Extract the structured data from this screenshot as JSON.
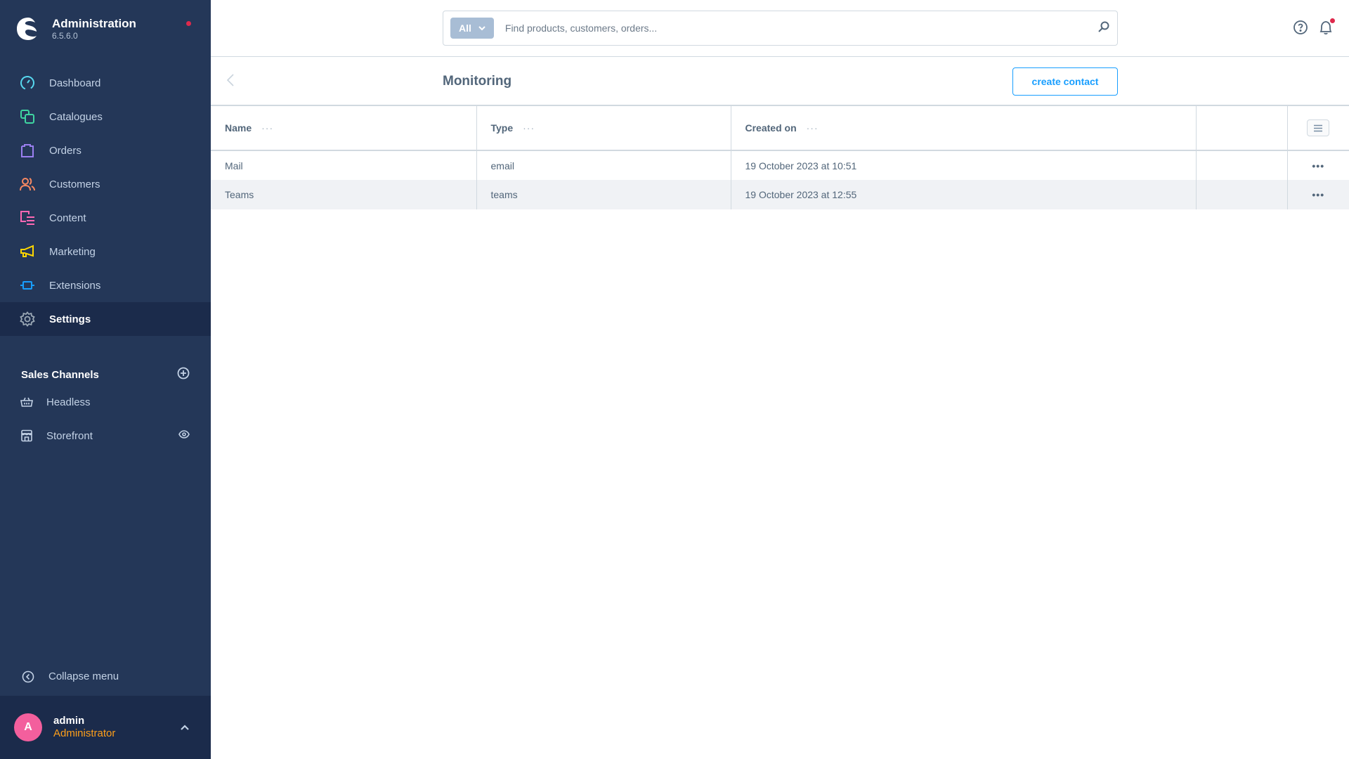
{
  "app": {
    "title": "Administration",
    "version": "6.5.6.0"
  },
  "sidebar": {
    "items": [
      {
        "label": "Dashboard",
        "icon": "dashboard-icon",
        "color": "#57d9f0"
      },
      {
        "label": "Catalogues",
        "icon": "catalogues-icon",
        "color": "#3fd5a1"
      },
      {
        "label": "Orders",
        "icon": "orders-icon",
        "color": "#9a7ff0"
      },
      {
        "label": "Customers",
        "icon": "customers-icon",
        "color": "#f88962"
      },
      {
        "label": "Content",
        "icon": "content-icon",
        "color": "#ff68b4"
      },
      {
        "label": "Marketing",
        "icon": "marketing-icon",
        "color": "#ffd700"
      },
      {
        "label": "Extensions",
        "icon": "extensions-icon",
        "color": "#189eff"
      },
      {
        "label": "Settings",
        "icon": "settings-icon",
        "color": "#9aa8b5",
        "active": true
      }
    ],
    "sales_channels": {
      "title": "Sales Channels",
      "items": [
        {
          "label": "Headless",
          "icon": "basket-icon"
        },
        {
          "label": "Storefront",
          "icon": "storefront-icon"
        }
      ]
    },
    "collapse_label": "Collapse menu",
    "user": {
      "initial": "A",
      "name": "admin",
      "role": "Administrator"
    }
  },
  "search": {
    "type_label": "All",
    "placeholder": "Find products, customers, orders..."
  },
  "page": {
    "title": "Monitoring",
    "create_button": "create contact"
  },
  "table": {
    "columns": [
      "Name",
      "Type",
      "Created on"
    ],
    "rows": [
      {
        "name": "Mail",
        "type": "email",
        "created_on": "19 October 2023 at 10:51"
      },
      {
        "name": "Teams",
        "type": "teams",
        "created_on": "19 October 2023 at 12:55"
      }
    ]
  },
  "colors": {
    "sidebar_bg": "#243758",
    "accent": "#189eff",
    "notification": "#de294c",
    "user_role": "#ff9f1a",
    "avatar": "#f35f9d"
  }
}
